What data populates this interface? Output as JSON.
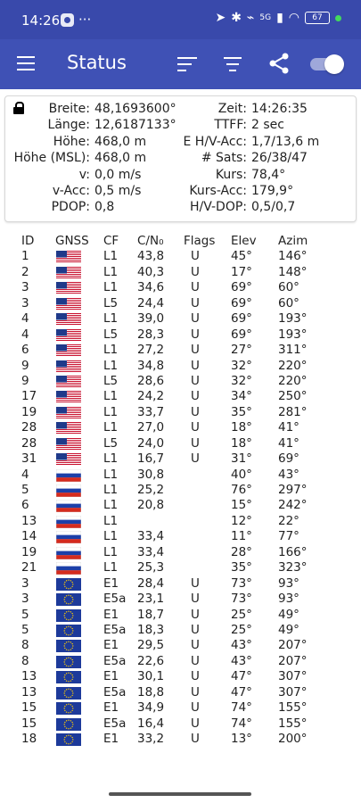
{
  "status_bar": {
    "time": "14:26",
    "overflow": "···",
    "network": "5G",
    "battery": "67"
  },
  "app_bar": {
    "title": "Status"
  },
  "info": {
    "rows": [
      {
        "label1": "Breite:",
        "value1": "48,1693600°",
        "label2": "Zeit:",
        "value2": "14:26:35"
      },
      {
        "label1": "Länge:",
        "value1": "12,6187133°",
        "label2": "TTFF:",
        "value2": "2 sec"
      },
      {
        "label1": "Höhe:",
        "value1": "468,0 m",
        "label2": "E H/V-Acc:",
        "value2": "1,7/13,6 m"
      },
      {
        "label1": "Höhe (MSL):",
        "value1": "468,0 m",
        "label2": "# Sats:",
        "value2": "26/38/47"
      },
      {
        "label1": "v:",
        "value1": "0,0 m/s",
        "label2": "Kurs:",
        "value2": "78,4°"
      },
      {
        "label1": "v-Acc:",
        "value1": "0,5 m/s",
        "label2": "Kurs-Acc:",
        "value2": "179,9°"
      },
      {
        "label1": "PDOP:",
        "value1": "0,8",
        "label2": "H/V-DOP:",
        "value2": "0,5/0,7"
      }
    ]
  },
  "table": {
    "headers": {
      "id": "ID",
      "gnss": "GNSS",
      "cf": "CF",
      "cn": "C/N₀",
      "flags": "Flags",
      "elev": "Elev",
      "azim": "Azim"
    },
    "rows": [
      {
        "id": "1",
        "gnss": "us",
        "cf": "L1",
        "cn": "43,8",
        "flags": "U",
        "elev": "45°",
        "azim": "146°"
      },
      {
        "id": "2",
        "gnss": "us",
        "cf": "L1",
        "cn": "40,3",
        "flags": "U",
        "elev": "17°",
        "azim": "148°"
      },
      {
        "id": "3",
        "gnss": "us",
        "cf": "L1",
        "cn": "34,6",
        "flags": "U",
        "elev": "69°",
        "azim": "60°"
      },
      {
        "id": "3",
        "gnss": "us",
        "cf": "L5",
        "cn": "24,4",
        "flags": "U",
        "elev": "69°",
        "azim": "60°"
      },
      {
        "id": "4",
        "gnss": "us",
        "cf": "L1",
        "cn": "39,0",
        "flags": "U",
        "elev": "69°",
        "azim": "193°"
      },
      {
        "id": "4",
        "gnss": "us",
        "cf": "L5",
        "cn": "28,3",
        "flags": "U",
        "elev": "69°",
        "azim": "193°"
      },
      {
        "id": "6",
        "gnss": "us",
        "cf": "L1",
        "cn": "27,2",
        "flags": "U",
        "elev": "27°",
        "azim": "311°"
      },
      {
        "id": "9",
        "gnss": "us",
        "cf": "L1",
        "cn": "34,8",
        "flags": "U",
        "elev": "32°",
        "azim": "220°"
      },
      {
        "id": "9",
        "gnss": "us",
        "cf": "L5",
        "cn": "28,6",
        "flags": "U",
        "elev": "32°",
        "azim": "220°"
      },
      {
        "id": "17",
        "gnss": "us",
        "cf": "L1",
        "cn": "24,2",
        "flags": "U",
        "elev": "34°",
        "azim": "250°"
      },
      {
        "id": "19",
        "gnss": "us",
        "cf": "L1",
        "cn": "33,7",
        "flags": "U",
        "elev": "35°",
        "azim": "281°"
      },
      {
        "id": "28",
        "gnss": "us",
        "cf": "L1",
        "cn": "27,0",
        "flags": "U",
        "elev": "18°",
        "azim": "41°"
      },
      {
        "id": "28",
        "gnss": "us",
        "cf": "L5",
        "cn": "24,0",
        "flags": "U",
        "elev": "18°",
        "azim": "41°"
      },
      {
        "id": "31",
        "gnss": "us",
        "cf": "L1",
        "cn": "16,7",
        "flags": "U",
        "elev": "31°",
        "azim": "69°"
      },
      {
        "id": "4",
        "gnss": "ru",
        "cf": "L1",
        "cn": "30,8",
        "flags": "",
        "elev": "40°",
        "azim": "43°"
      },
      {
        "id": "5",
        "gnss": "ru",
        "cf": "L1",
        "cn": "25,2",
        "flags": "",
        "elev": "76°",
        "azim": "297°"
      },
      {
        "id": "6",
        "gnss": "ru",
        "cf": "L1",
        "cn": "20,8",
        "flags": "",
        "elev": "15°",
        "azim": "242°"
      },
      {
        "id": "13",
        "gnss": "ru",
        "cf": "L1",
        "cn": "",
        "flags": "",
        "elev": "12°",
        "azim": "22°"
      },
      {
        "id": "14",
        "gnss": "ru",
        "cf": "L1",
        "cn": "33,4",
        "flags": "",
        "elev": "11°",
        "azim": "77°"
      },
      {
        "id": "19",
        "gnss": "ru",
        "cf": "L1",
        "cn": "33,4",
        "flags": "",
        "elev": "28°",
        "azim": "166°"
      },
      {
        "id": "21",
        "gnss": "ru",
        "cf": "L1",
        "cn": "25,3",
        "flags": "",
        "elev": "35°",
        "azim": "323°"
      },
      {
        "id": "3",
        "gnss": "eu",
        "cf": "E1",
        "cn": "28,4",
        "flags": "U",
        "elev": "73°",
        "azim": "93°"
      },
      {
        "id": "3",
        "gnss": "eu",
        "cf": "E5a",
        "cn": "23,1",
        "flags": "U",
        "elev": "73°",
        "azim": "93°"
      },
      {
        "id": "5",
        "gnss": "eu",
        "cf": "E1",
        "cn": "18,7",
        "flags": "U",
        "elev": "25°",
        "azim": "49°"
      },
      {
        "id": "5",
        "gnss": "eu",
        "cf": "E5a",
        "cn": "18,3",
        "flags": "U",
        "elev": "25°",
        "azim": "49°"
      },
      {
        "id": "8",
        "gnss": "eu",
        "cf": "E1",
        "cn": "29,5",
        "flags": "U",
        "elev": "43°",
        "azim": "207°"
      },
      {
        "id": "8",
        "gnss": "eu",
        "cf": "E5a",
        "cn": "22,6",
        "flags": "U",
        "elev": "43°",
        "azim": "207°"
      },
      {
        "id": "13",
        "gnss": "eu",
        "cf": "E1",
        "cn": "30,1",
        "flags": "U",
        "elev": "47°",
        "azim": "307°"
      },
      {
        "id": "13",
        "gnss": "eu",
        "cf": "E5a",
        "cn": "18,8",
        "flags": "U",
        "elev": "47°",
        "azim": "307°"
      },
      {
        "id": "15",
        "gnss": "eu",
        "cf": "E1",
        "cn": "34,9",
        "flags": "U",
        "elev": "74°",
        "azim": "155°"
      },
      {
        "id": "15",
        "gnss": "eu",
        "cf": "E5a",
        "cn": "16,4",
        "flags": "U",
        "elev": "74°",
        "azim": "155°"
      },
      {
        "id": "18",
        "gnss": "eu",
        "cf": "E1",
        "cn": "33,2",
        "flags": "U",
        "elev": "13°",
        "azim": "200°"
      }
    ]
  }
}
